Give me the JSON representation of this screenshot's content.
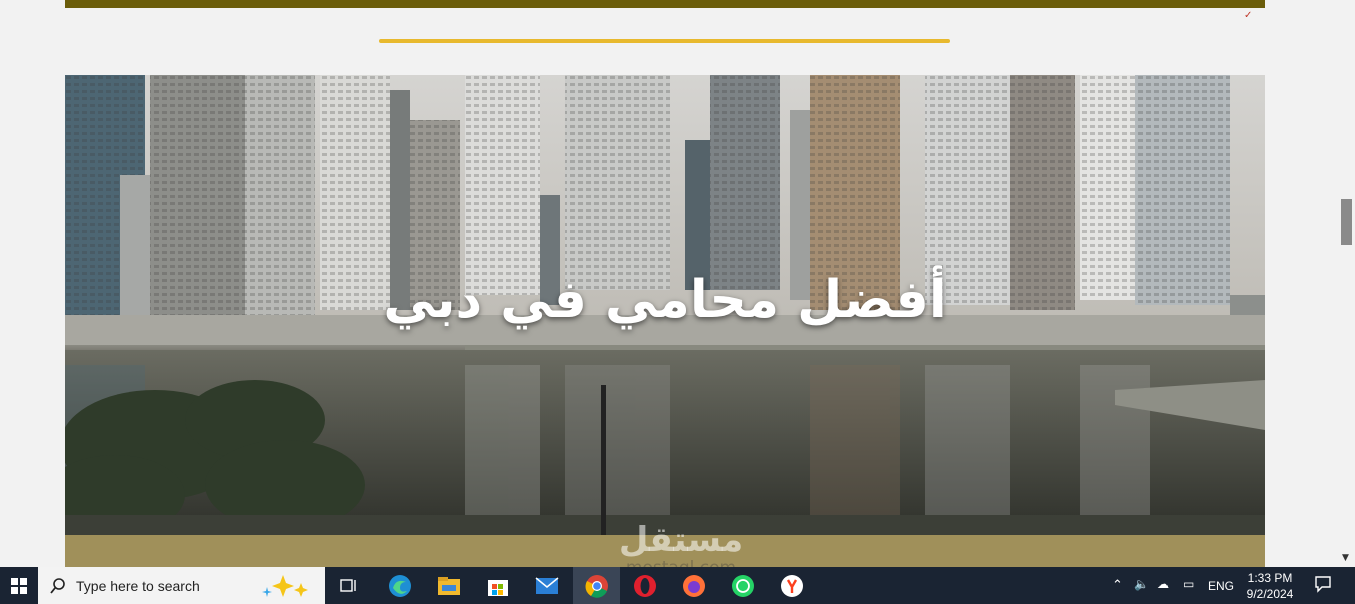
{
  "hero": {
    "title": "أفضل محامي في دبي"
  },
  "watermark": {
    "arabic": "مستقل",
    "latin": "mostaql.com"
  },
  "taskbar": {
    "search_placeholder": "Type here to search",
    "apps": [
      "task-view",
      "edge",
      "file-explorer",
      "microsoft-store",
      "mail",
      "chrome",
      "opera",
      "firefox",
      "whatsapp",
      "yandex"
    ],
    "language": "ENG",
    "time": "1:33 PM",
    "date": "9/2/2024"
  },
  "colors": {
    "top_bar": "#6b5d0a",
    "accent_line": "#e8b92e",
    "olive_band": "#a0905a",
    "taskbar": "#1a2433"
  }
}
